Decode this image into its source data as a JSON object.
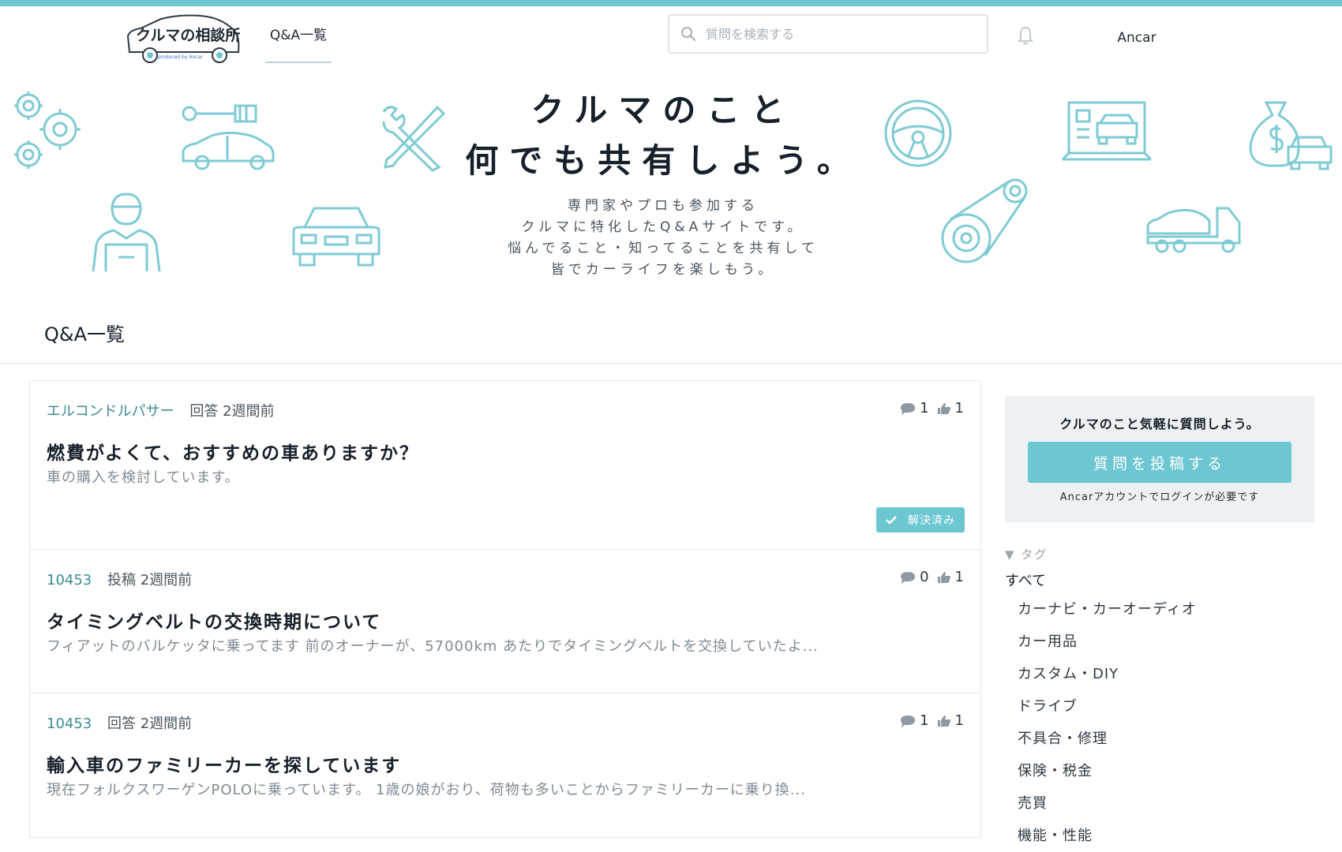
{
  "header": {
    "logo_text": "クルマの相談所",
    "logo_sub": "produced by Ancar",
    "nav_tab": "Q&A一覧",
    "search_placeholder": "質問を検索する",
    "user_name": "Ancar"
  },
  "hero": {
    "title_line1": "クルマのこと",
    "title_line2": "何でも共有しよう。",
    "desc_line1": "専門家やプロも参加する",
    "desc_line2": "クルマに特化したQ&Aサイトです。",
    "desc_line3": "悩んでること・知ってることを共有して",
    "desc_line4": "皆でカーライフを楽しもう。"
  },
  "section_title": "Q&A一覧",
  "questions": [
    {
      "author": "エルコンドルパサー",
      "action": "回答 2週間前",
      "comments": "1",
      "likes": "1",
      "title": "燃費がよくて、おすすめの車ありますか？",
      "body": "車の購入を検討しています。",
      "badge": "解決済み"
    },
    {
      "author": "10453",
      "action": "投稿 2週間前",
      "comments": "0",
      "likes": "1",
      "title": "タイミングベルトの交換時期について",
      "body": "フィアットのバルケッタに乗ってます 前のオーナーが、57000km あたりでタイミングベルトを交換していたよ..."
    },
    {
      "author": "10453",
      "action": "回答 2週間前",
      "comments": "1",
      "likes": "1",
      "title": "輸入車のファミリーカーを探しています",
      "body": "現在フォルクスワーゲンPOLOに乗っています。 1歳の娘がおり、荷物も多いことからファミリーカーに乗り換..."
    }
  ],
  "sidebar": {
    "cta_heading": "クルマのこと気軽に質問しよう。",
    "cta_button": "質問を投稿する",
    "cta_note": "Ancarアカウントでログインが必要です",
    "tag_header": "▼ タグ",
    "tag_all": "すべて",
    "tags": [
      "カーナビ・カーオーディオ",
      "カー用品",
      "カスタム・DIY",
      "ドライブ",
      "不具合・修理",
      "保険・税金",
      "売買",
      "機能・性能"
    ]
  },
  "colors": {
    "accent": "#6cc7d1",
    "author_link": "#3d8c97",
    "icon_line": "#7fcbd4"
  }
}
